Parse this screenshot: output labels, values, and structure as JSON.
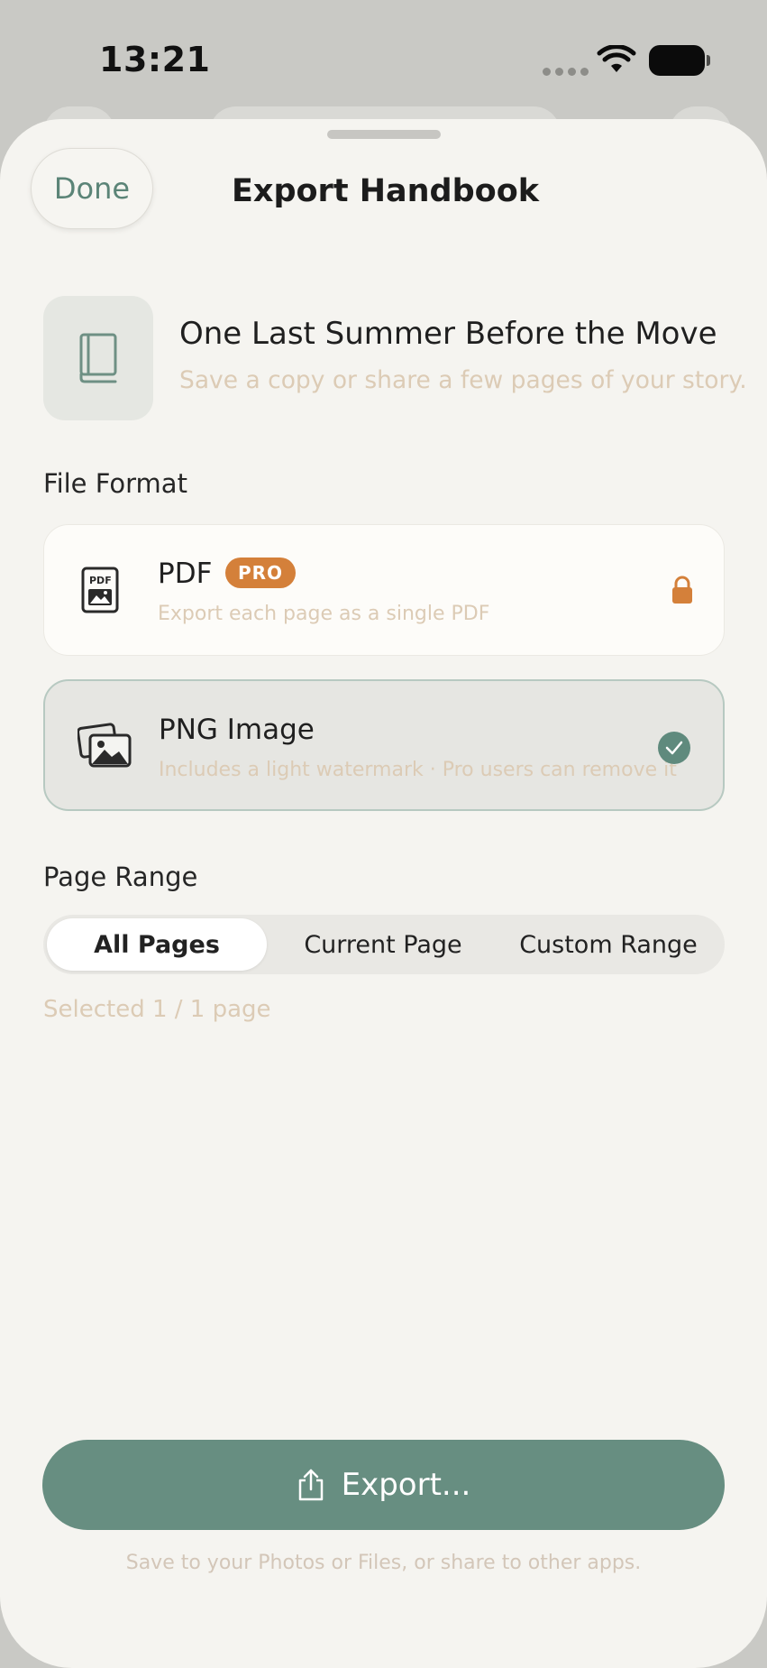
{
  "status_bar": {
    "time": "13:21"
  },
  "sheet": {
    "done_label": "Done",
    "title": "Export Handbook"
  },
  "project": {
    "title": "One Last Summer Before the Move",
    "subtitle": "Save a copy or share a few pages of your story.",
    "icon": "book-icon"
  },
  "file_format": {
    "label": "File Format",
    "options": [
      {
        "name": "PDF",
        "badge": "PRO",
        "description": "Export each page as a single PDF",
        "icon": "pdf-file-icon",
        "status_icon": "lock-icon",
        "locked": true,
        "selected": false
      },
      {
        "name": "PNG Image",
        "description": "Includes a light watermark · Pro users can remove it",
        "icon": "images-icon",
        "status_icon": "checkmark-icon",
        "locked": false,
        "selected": true
      }
    ]
  },
  "page_range": {
    "label": "Page Range",
    "segments": [
      "All Pages",
      "Current Page",
      "Custom Range"
    ],
    "selected": "All Pages",
    "selection_text": "Selected 1 / 1 page"
  },
  "export": {
    "button_label": "Export...",
    "icon": "share-icon",
    "footer_note": "Save to your Photos or Files, or share to other apps."
  },
  "colors": {
    "accent": "#678e81",
    "pro_badge": "#d4803a",
    "muted_text": "#dccbb5",
    "sheet_background": "#f5f4f0"
  }
}
